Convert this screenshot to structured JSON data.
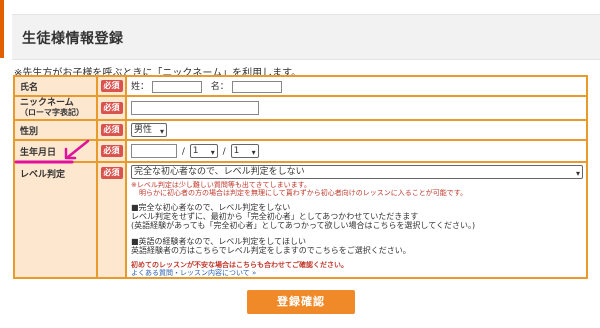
{
  "page": {
    "title": "生徒様情報登録"
  },
  "note": "※先生方がお子様を呼ぶときに「ニックネーム」を利用します。",
  "required_label": "必須",
  "form": {
    "name": {
      "label": "氏名",
      "sei_label": "姓：",
      "mei_label": "名："
    },
    "nickname": {
      "label": "ニックネーム",
      "sublabel": "（ローマ字表記）"
    },
    "gender": {
      "label": "性別",
      "selected": "男性"
    },
    "birthdate": {
      "label": "生年月日",
      "month": "1",
      "day": "1",
      "sep1": "/",
      "sep2": "/"
    },
    "level": {
      "label": "レベル判定",
      "selected": "完全な初心者なので、レベル判定をしない",
      "warn1": "※レベル判定は少し難しい質問等も出てきてしまいます。",
      "warn2": "明らかに初心者の方の場合は判定を無理にして貰わずから初心者向けのレッスンに入ることが可能です。",
      "opt1_head": "■完全な初心者なので、レベル判定をしない",
      "opt1_l1": "レベル判定をせずに、最初から「完全初心者」としてあつかわせていただきます",
      "opt1_l2": "(英語経験があっても「完全初心者」としてあつかって欲しい場合はこちらを選択してください。)",
      "opt2_head": "■英語の経験者なので、レベル判定をしてほしい",
      "opt2_l1": "英語経験者の方はこちらでレベル判定をしますのでこちらをご選択ください。",
      "note_red": "初めてのレッスンが不安な場合はこちらも合わせてご確認ください。",
      "faq_link": "よくある質問・レッスン内容について »"
    }
  },
  "submit_label": "登録確認",
  "colors": {
    "accent": "#f08a28",
    "border": "#e89a2c",
    "label_bg": "#fde7cf",
    "required_badge": "#d9534f",
    "annotation": "#e0119a"
  }
}
